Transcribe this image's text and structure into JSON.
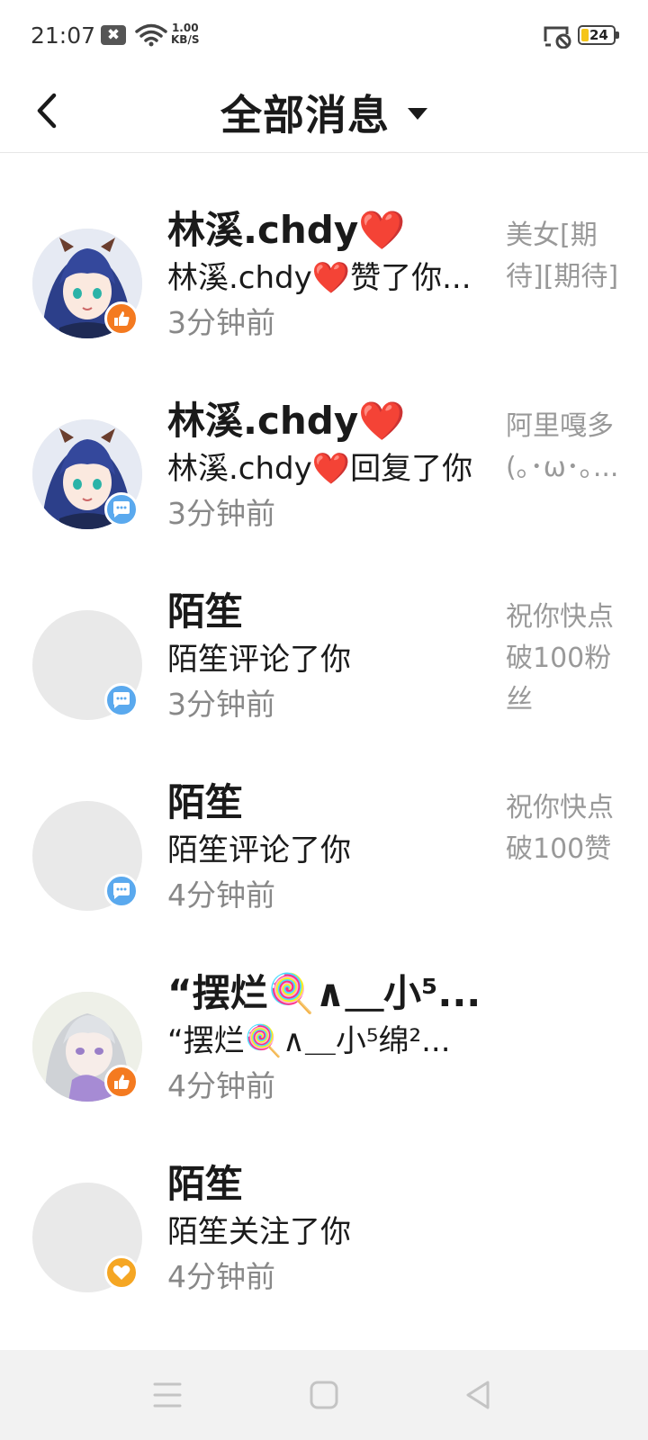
{
  "status_bar": {
    "time": "21:07",
    "notif_glyph": "✖",
    "speed_value": "1.00",
    "speed_unit": "KB/S",
    "battery": "24",
    "battery_level": 0.24
  },
  "header": {
    "title": "全部消息",
    "back_icon": "chevron-left-icon",
    "dropdown_icon": "caret-down-icon"
  },
  "messages": [
    {
      "name": "",
      "desc": "",
      "time": "3分钟前",
      "preview": "",
      "badge": "follow",
      "avatar": "anime-blue-hair"
    },
    {
      "name": "林溪.chdy❤️",
      "desc": "林溪.chdy❤️赞了你...",
      "time": "3分钟前",
      "preview": "美女[期待][期待]",
      "badge": "like",
      "avatar": "anime-blue-hair"
    },
    {
      "name": "林溪.chdy❤️",
      "desc": "林溪.chdy❤️回复了你",
      "time": "3分钟前",
      "preview": "阿里嘎多(｡･ω･｡...",
      "badge": "comment",
      "avatar": "anime-blue-hair"
    },
    {
      "name": "陌笙",
      "desc": "陌笙评论了你",
      "time": "3分钟前",
      "preview": "祝你快点破100粉丝",
      "badge": "comment",
      "avatar": "blank"
    },
    {
      "name": "陌笙",
      "desc": "陌笙评论了你",
      "time": "4分钟前",
      "preview": "祝你快点破100赞",
      "badge": "comment",
      "avatar": "blank"
    },
    {
      "name": "“摆烂🍭∧＿小⁵...",
      "desc": "“摆烂🍭∧＿小⁵绵²...",
      "time": "4分钟前",
      "preview": "",
      "badge": "like",
      "avatar": "anime-silver-hair"
    },
    {
      "name": "陌笙",
      "desc": "陌笙关注了你",
      "time": "4分钟前",
      "preview": "",
      "badge": "follow",
      "avatar": "blank"
    }
  ],
  "colors": {
    "like_badge": "#f47a20",
    "follow_badge": "#f5a623",
    "comment_badge": "#5aa9ee",
    "time_text": "#888888",
    "preview_text": "#999999"
  },
  "navbar": {
    "menu_icon": "menu-icon",
    "home_icon": "square-home-icon",
    "back_icon": "triangle-back-icon"
  }
}
